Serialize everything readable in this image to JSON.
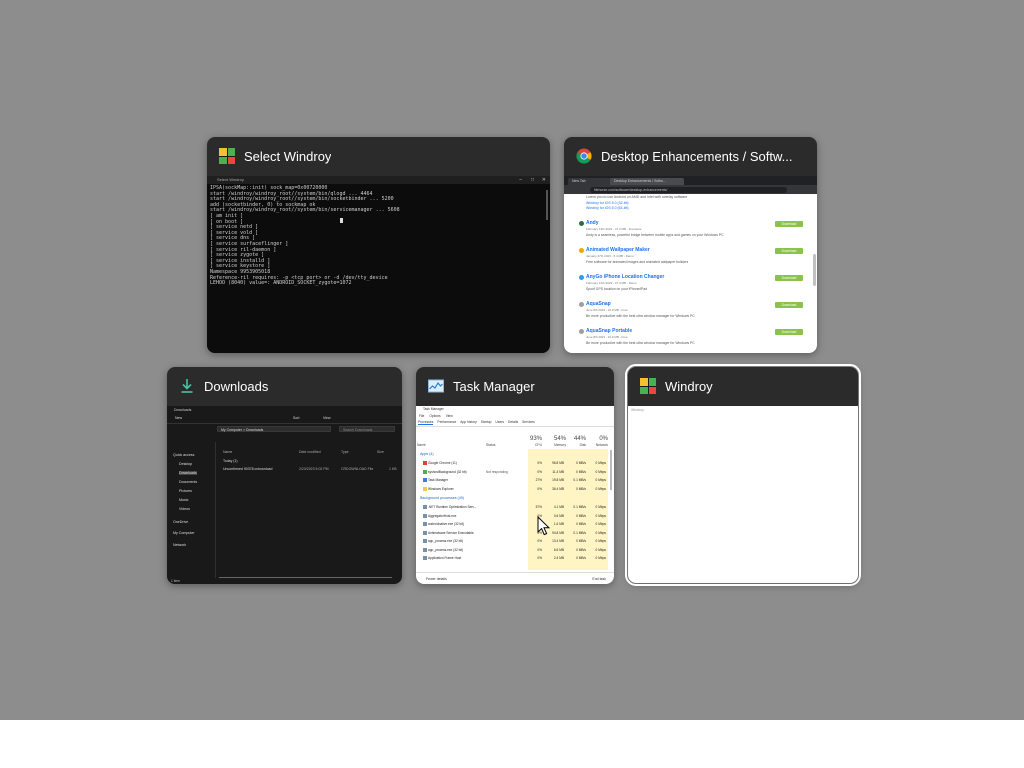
{
  "switcher": {
    "windows": [
      {
        "title": "Select Windroy",
        "icon": "windroy-icon"
      },
      {
        "title": "Desktop Enhancements / Softw...",
        "icon": "chrome-icon"
      },
      {
        "title": "Downloads",
        "icon": "download-arrow-icon"
      },
      {
        "title": "Task Manager",
        "icon": "task-manager-icon"
      },
      {
        "title": "Windroy",
        "icon": "windroy-icon",
        "selected": true
      }
    ]
  },
  "console_preview": {
    "window_title": "Select Windroy",
    "lines": [
      "IPSA(sockMap::init) sock_map=0x00720000",
      "start /windroy/windroy_root//system/bin/qlogd ... 4464",
      "start /windroy/windroy_root//system/bin/socketbinder ... 5200",
      "add (socketbinder, 0) to sockmap ok",
      "start /windroy/windroy_root//system/bin/servicemanager ... 5608",
      "[ am init ]",
      "[ on boot ]",
      "[ service netd ]",
      "[ service vold ]",
      "[ service dns ]",
      "[ service surfaceflinger ]",
      "[ service ril-daemon ]",
      "[ service zygote ]",
      "[ service installd ]",
      "[ service keystore ]",
      "Namespace 9953905018",
      "Reference-ril requires: -p <tcp port> or -d /dev/tty_device",
      "LEHOO (8040) value=: ANDROID_SOCKET_zygote=1072"
    ]
  },
  "chrome_preview": {
    "tabs": [
      "New Tab",
      "Desktop Enhancements / Softw..."
    ],
    "url": "filehorse.com/software/desktop-enhancements/",
    "top_links": [
      "Lorem you to use Android on AMD and Intel with overlay software",
      "Windroy for iOS 5.0 (32-bit)",
      "Windroy for iOS 5.0 (64-bit)"
    ],
    "items": [
      {
        "name": "Andy",
        "meta": "February 13th 2023 - 47.3 MB - Freeware",
        "desc": "Andy is a seamless, powerful bridge between mobile apps and games on your Windows PC",
        "button": "Download",
        "color": "#2f6e3b"
      },
      {
        "name": "Animated Wallpaper Maker",
        "meta": "January 27th 2023 - 8.4 MB - Demo",
        "desc": "Free software for animated images and animated wallpaper builders",
        "button": "Download",
        "color": "#f2a500"
      },
      {
        "name": "AnyGo iPhone Location Changer",
        "meta": "February 14th 2023 - 47.4 MB - Demo",
        "desc": "Spoof GPS location on your iPhone/iPad",
        "button": "Download",
        "color": "#2a9df4"
      },
      {
        "name": "AquaSnap",
        "meta": "June 8th 2023 - 16.9 MB - Free",
        "desc": "Be more productive with the best ultra window manager for Windows PC",
        "button": "Download",
        "color": "#9e9e9e"
      },
      {
        "name": "AquaSnap Portable",
        "meta": "June 8th 2023 - 16.9 MB - Free",
        "desc": "Be more productive with the best ultra window manager for Windows PC",
        "button": "Download",
        "color": "#9e9e9e"
      }
    ]
  },
  "explorer_preview": {
    "window_title": "Downloads",
    "toolbar": {
      "new_label": "New",
      "sort_label": "Sort",
      "view_label": "View"
    },
    "breadcrumb": "My Computer > Downloads",
    "search_placeholder": "Search Downloads",
    "columns": {
      "name": "Name",
      "date": "Date modified",
      "type": "Type",
      "size": "Size"
    },
    "group": "Today (1)",
    "files": [
      {
        "name": "Unconfirmed 90378.crdownload",
        "date": "2/23/2023 5:02 PM",
        "type": "CRDOWNLOAD File",
        "size": "1 KB"
      }
    ],
    "sidebar": [
      "Quick access",
      "Desktop",
      "Downloads",
      "Documents",
      "Pictures",
      "Music",
      "Videos",
      "OneDrive",
      "My Computer",
      "Network"
    ],
    "status": "1 item"
  },
  "taskmgr_preview": {
    "window_title": "Task Manager",
    "menu": [
      "File",
      "Options",
      "View"
    ],
    "tabs": [
      "Processes",
      "Performance",
      "App history",
      "Startup",
      "Users",
      "Details",
      "Services"
    ],
    "columns": {
      "name": "Name",
      "status": "Status"
    },
    "stats": [
      {
        "pct": "93%",
        "label": "CPU"
      },
      {
        "pct": "54%",
        "label": "Memory"
      },
      {
        "pct": "44%",
        "label": "Disk"
      },
      {
        "pct": "0%",
        "label": "Network"
      }
    ],
    "apps_header": "Apps (4)",
    "apps": [
      {
        "name": "Google Chrome (11)",
        "status": "",
        "cpu": "0%",
        "mem": "96.8 MB",
        "disk": "0 MB/s",
        "net": "0 Mbps",
        "color": "#db4437"
      },
      {
        "name": "syshostBackground (32 bit)",
        "status": "Not responding",
        "cpu": "0%",
        "mem": "11.4 MB",
        "disk": "0 MB/s",
        "net": "0 Mbps",
        "color": "#4caf50"
      },
      {
        "name": "Task Manager",
        "status": "",
        "cpu": "27%",
        "mem": "19.8 MB",
        "disk": "0.1 MB/s",
        "net": "0 Mbps",
        "color": "#3b7dd8"
      },
      {
        "name": "Windows Explorer",
        "status": "",
        "cpu": "0%",
        "mem": "36.4 MB",
        "disk": "0 MB/s",
        "net": "0 Mbps",
        "color": "#f2c94c"
      }
    ],
    "bg_header": "Background processes (49)",
    "bg": [
      {
        "name": ".NET Runtime Optimization Serv...",
        "cpu": "57%",
        "mem": "4.1 MB",
        "disk": "0.1 MB/s",
        "net": "0 Mbps"
      },
      {
        "name": "AggregatorHost.exe",
        "cpu": "0%",
        "mem": "0.6 MB",
        "disk": "0 MB/s",
        "net": "0 Mbps"
      },
      {
        "name": "androidnative.exe (32 bit)",
        "cpu": "0%",
        "mem": "1.6 MB",
        "disk": "0 MB/s",
        "net": "0 Mbps"
      },
      {
        "name": "Antimalware Service Executable",
        "cpu": "0%",
        "mem": "94.8 MB",
        "disk": "0.1 MB/s",
        "net": "0 Mbps"
      },
      {
        "name": "app_process.exe (32 bit)",
        "cpu": "0%",
        "mem": "13.4 MB",
        "disk": "0 MB/s",
        "net": "0 Mbps"
      },
      {
        "name": "app_process.exe (32 bit)",
        "cpu": "0%",
        "mem": "6.6 MB",
        "disk": "0 MB/s",
        "net": "0 Mbps"
      },
      {
        "name": "Application Frame Host",
        "cpu": "0%",
        "mem": "2.4 MB",
        "disk": "0 MB/s",
        "net": "0 Mbps"
      }
    ],
    "footer": {
      "fewer": "Fewer details",
      "end_task": "End task"
    }
  },
  "windroy_preview": {
    "label": "Windroy"
  },
  "colors": {
    "backdrop": "#8d8d8d",
    "thumb_header": "#2b2b2b",
    "download_button": "#8bc34a",
    "link": "#1a73e8"
  }
}
